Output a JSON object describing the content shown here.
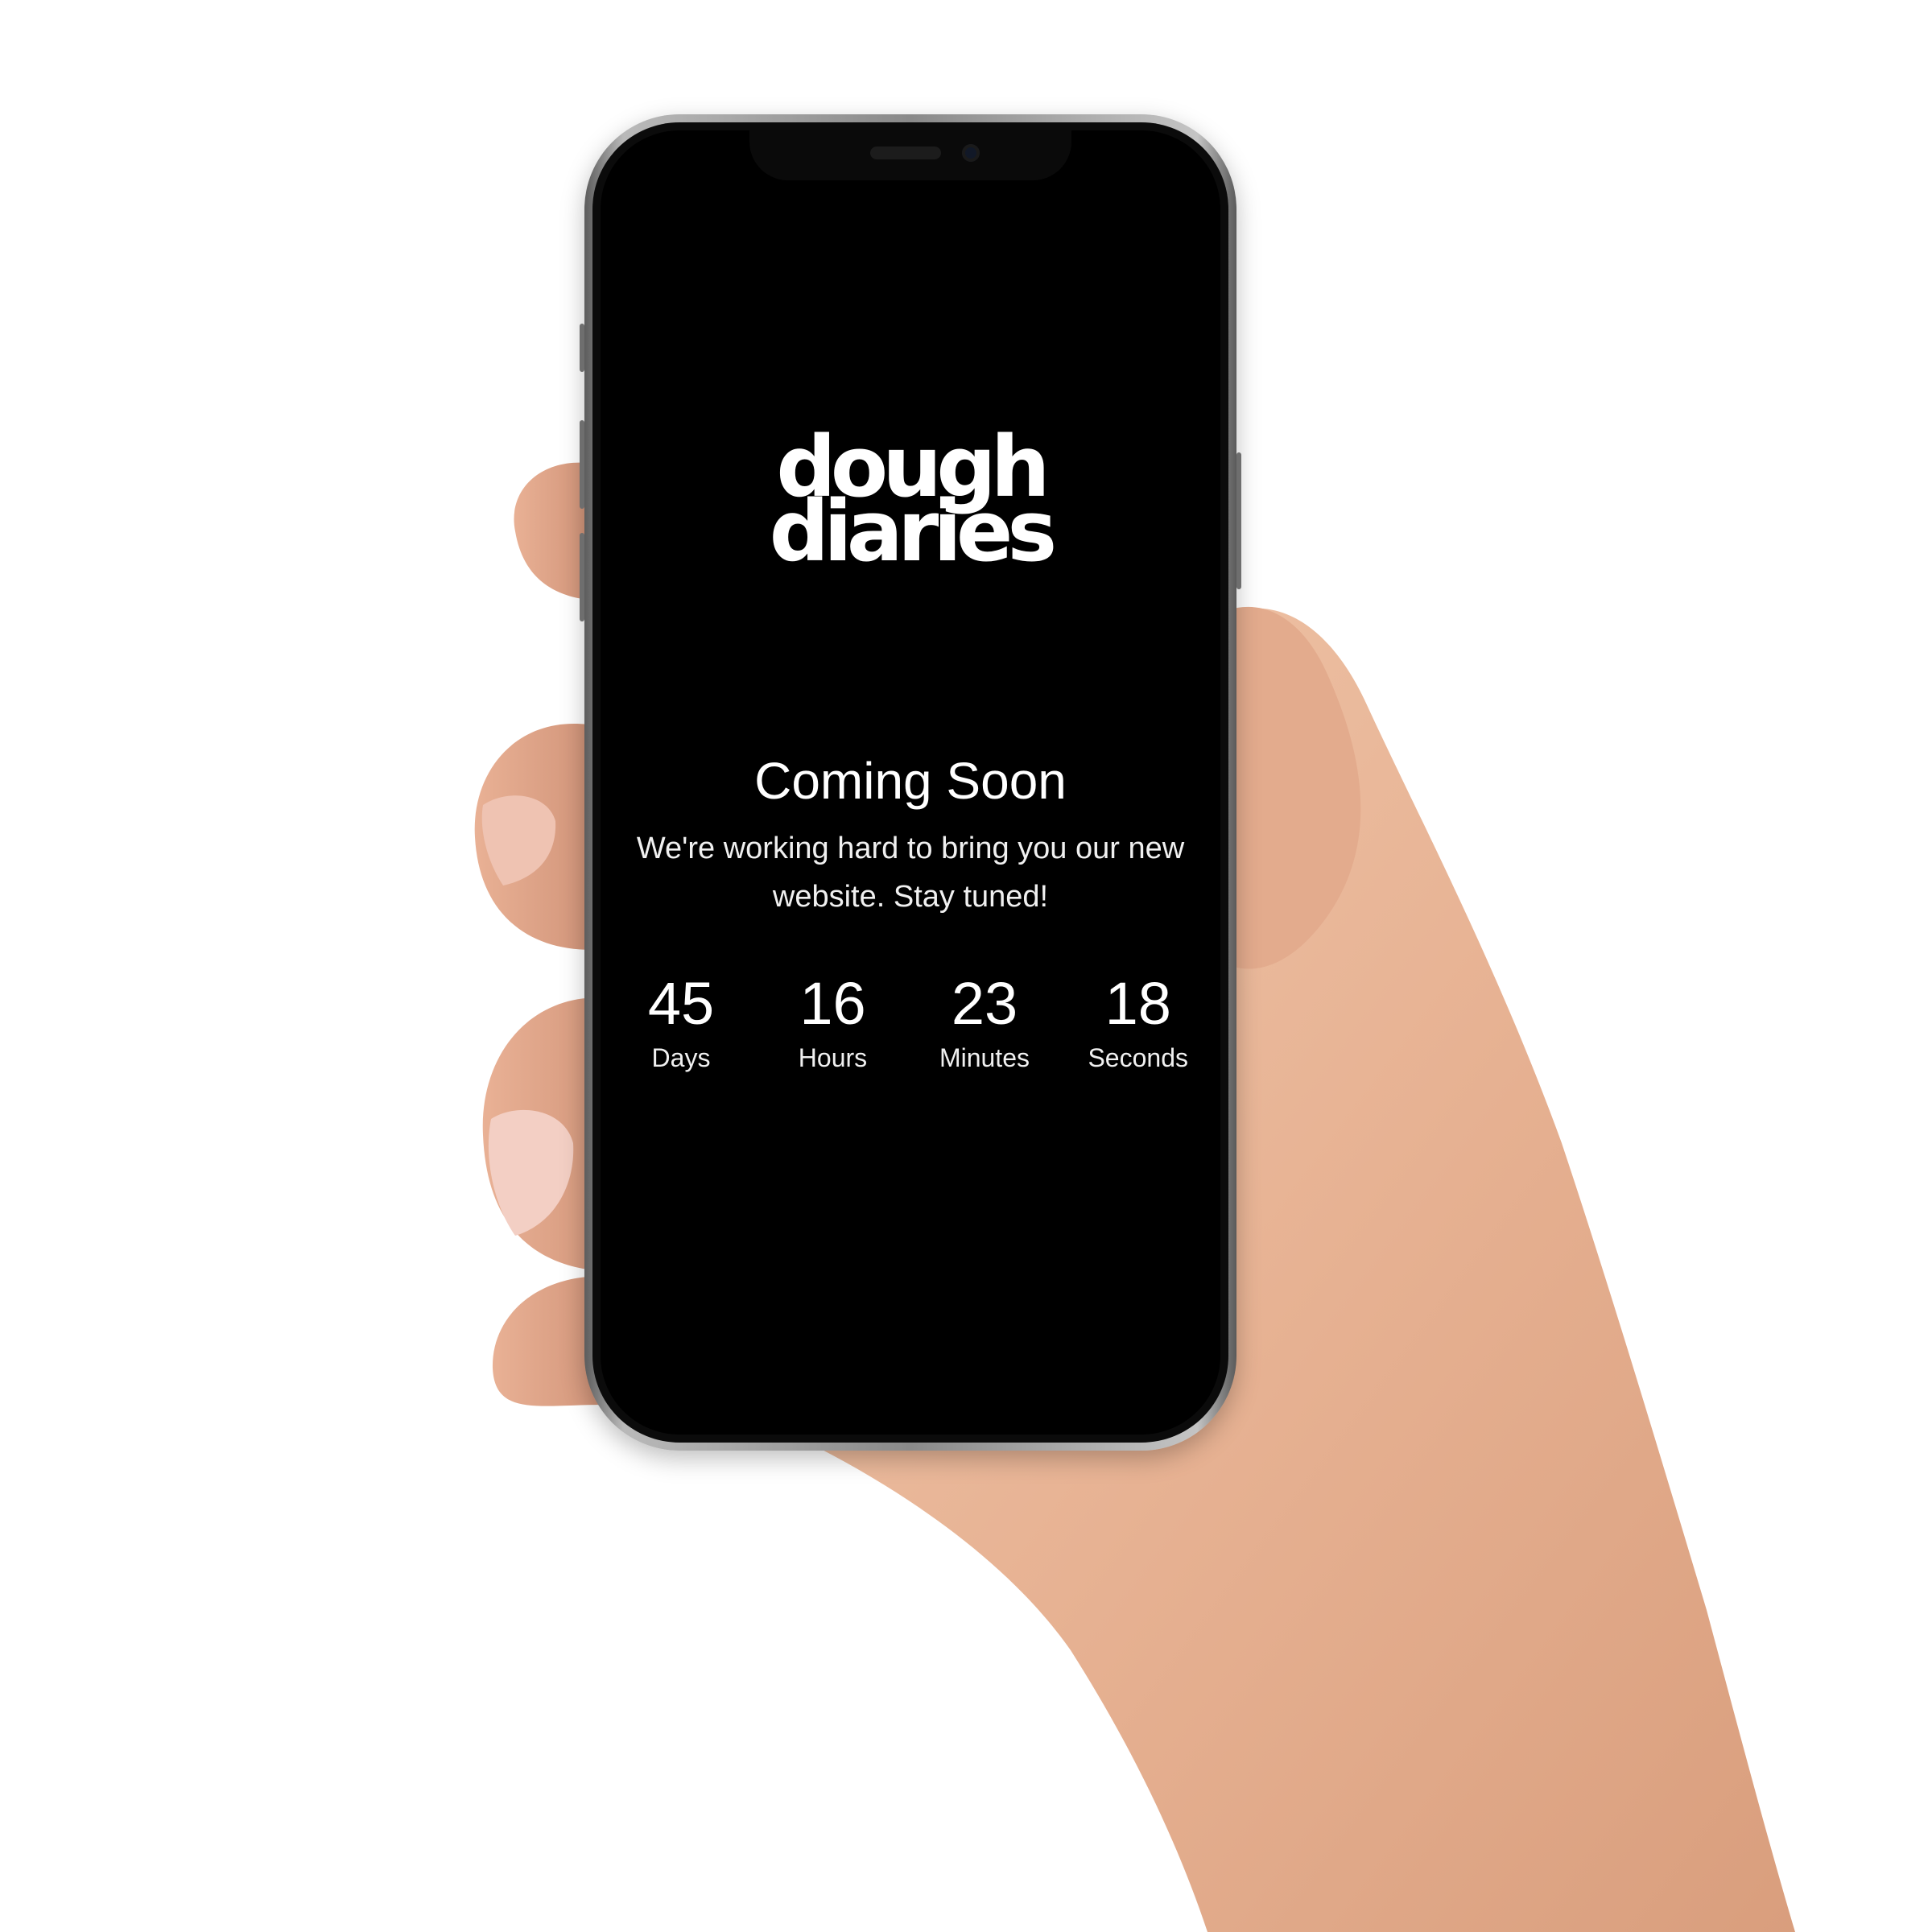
{
  "brand": {
    "logo_line_1": "dough",
    "logo_line_2": "diaries"
  },
  "hero": {
    "title": "Coming Soon",
    "subtitle": "We're working hard to bring you our new website. Stay tuned!"
  },
  "countdown": {
    "units": [
      {
        "value": "45",
        "label": "Days"
      },
      {
        "value": "16",
        "label": "Hours"
      },
      {
        "value": "23",
        "label": "Minutes"
      },
      {
        "value": "18",
        "label": "Seconds"
      }
    ]
  },
  "colors": {
    "screen_background": "#000000",
    "text": "#ffffff",
    "page_background": "#ffffff",
    "skin": "#e8b899"
  }
}
